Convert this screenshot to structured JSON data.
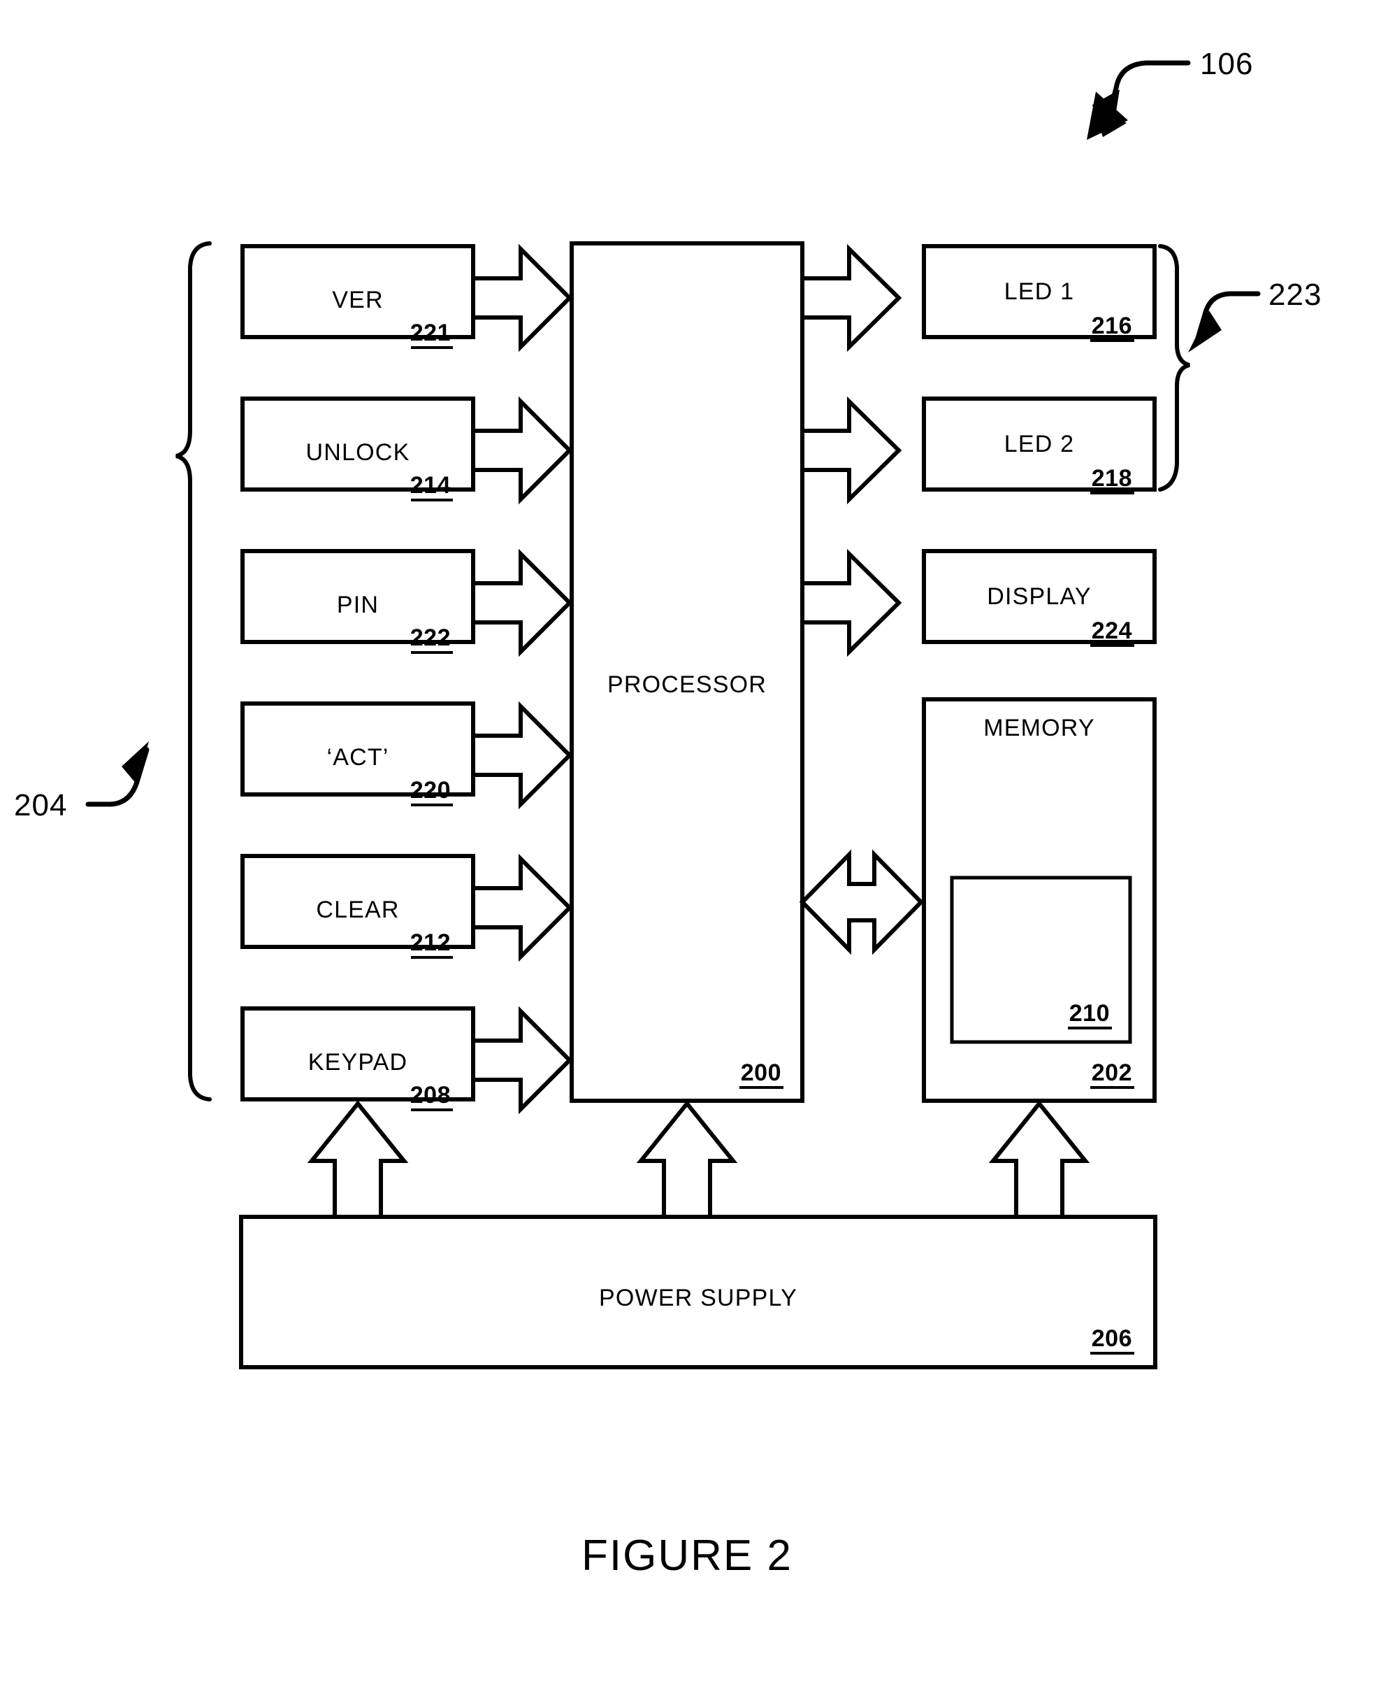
{
  "figure": {
    "caption": "FIGURE 2",
    "top_callout": "106",
    "left_group_callout": "204",
    "right_group_callout": "223"
  },
  "inputs": {
    "group_ref": "204",
    "boxes": [
      {
        "label": "VER",
        "ref": "221"
      },
      {
        "label": "UNLOCK",
        "ref": "214"
      },
      {
        "label": "PIN",
        "ref": "222"
      },
      {
        "label": "‘ACT’",
        "ref": "220"
      },
      {
        "label": "CLEAR",
        "ref": "212"
      },
      {
        "label": "KEYPAD",
        "ref": "208"
      }
    ]
  },
  "processor": {
    "label": "PROCESSOR",
    "ref": "200"
  },
  "outputs": {
    "group_ref": "223",
    "boxes": [
      {
        "label": "LED 1",
        "ref": "216"
      },
      {
        "label": "LED 2",
        "ref": "218"
      },
      {
        "label": "DISPLAY",
        "ref": "224"
      }
    ]
  },
  "memory": {
    "label": "MEMORY",
    "ref": "202",
    "inner_ref": "210"
  },
  "power_supply": {
    "label": "POWER SUPPLY",
    "ref": "206"
  },
  "icons": {
    "input_arrow": "block-arrow-right-icon",
    "output_arrow": "block-arrow-right-icon",
    "memory_bus_arrow": "block-arrow-double-horizontal-icon",
    "power_arrow": "block-arrow-up-icon",
    "left_brace": "curly-brace-left-icon",
    "right_brace": "curly-brace-right-icon",
    "callout_leader": "curved-leader-arrow-icon"
  },
  "colors": {
    "ink": "#000000",
    "paper": "#ffffff"
  }
}
